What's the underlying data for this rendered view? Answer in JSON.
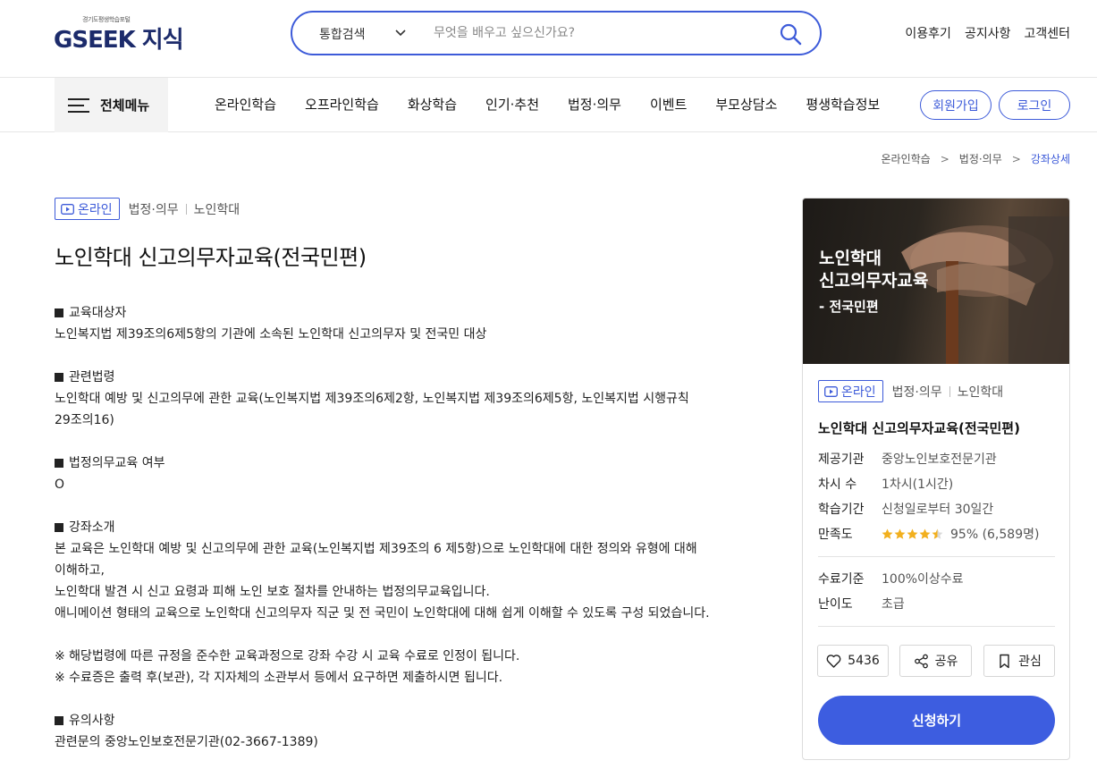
{
  "header": {
    "logo_sub": "경기도평생학습포털",
    "logo_text": "GSEEK 지식",
    "search_category": "통합검색",
    "search_placeholder": "무엇을 배우고 싶으신가요?",
    "links": [
      "이용후기",
      "공지사항",
      "고객센터"
    ]
  },
  "nav": {
    "all_menu": "전체메뉴",
    "items": [
      "온라인학습",
      "오프라인학습",
      "화상학습",
      "인기·추천",
      "법정·의무",
      "이벤트",
      "부모상담소",
      "평생학습정보"
    ],
    "join": "회원가입",
    "login": "로그인"
  },
  "breadcrumb": [
    "온라인학습",
    "법정·의무",
    "강좌상세"
  ],
  "course": {
    "badge": "온라인",
    "category1": "법정·의무",
    "category2": "노인학대",
    "title": "노인학대 신고의무자교육(전국민편)"
  },
  "sections": [
    {
      "heading": "교육대상자",
      "lines": [
        "노인복지법 제39조의6제5항의 기관에 소속된 노인학대 신고의무자 및 전국민 대상"
      ]
    },
    {
      "heading": "관련법령",
      "lines": [
        "노인학대 예방 및 신고의무에 관한 교육(노인복지법 제39조의6제2항, 노인복지법 제39조의6제5항, 노인복지법 시행규칙",
        "29조의16)"
      ]
    },
    {
      "heading": "법정의무교육 여부",
      "lines": [
        "O"
      ]
    },
    {
      "heading": "강좌소개",
      "lines": [
        "본 교육은 노인학대 예방 및 신고의무에 관한 교육(노인복지법 제39조의 6 제5항)으로 노인학대에 대한 정의와 유형에 대해",
        "이해하고,",
        "노인학대 발견 시 신고 요령과 피해 노인 보호 절차를 안내하는 법정의무교육입니다.",
        "애니메이션 형태의 교육으로 노인학대 신고의무자 직군 및 전 국민이 노인학대에 대해 쉽게 이해할 수 있도록 구성 되었습니다."
      ]
    },
    {
      "heading": "",
      "lines": [
        "※ 해당법령에 따른 규정을 준수한 교육과정으로 강좌 수강 시 교육 수료로 인정이 됩니다.",
        "※ 수료증은 출력 후(보관), 각 지자체의 소관부서 등에서 요구하면 제출하시면 됩니다."
      ]
    },
    {
      "heading": "유의사항",
      "lines": [
        "관련문의 중앙노인보호전문기관(02-3667-1389)"
      ]
    }
  ],
  "card": {
    "thumb_line1": "노인학대",
    "thumb_line2": "신고의무자교육",
    "thumb_line3": "- 전국민편",
    "badge": "온라인",
    "category1": "법정·의무",
    "category2": "노인학대",
    "title": "노인학대 신고의무자교육(전국민편)",
    "info": [
      {
        "k": "제공기관",
        "v": "중앙노인보호전문기관"
      },
      {
        "k": "차시 수",
        "v": "1차시(1시간)"
      },
      {
        "k": "학습기간",
        "v": "신청일로부터 30일간"
      }
    ],
    "rating_label": "만족도",
    "rating_stars": 4.5,
    "rating_text": "95% (6,589명)",
    "info2": [
      {
        "k": "수료기준",
        "v": "100%이상수료"
      },
      {
        "k": "난이도",
        "v": "초급"
      }
    ],
    "like_count": "5436",
    "share": "공유",
    "favorite": "관심",
    "apply": "신청하기"
  },
  "colors": {
    "accent": "#3d5bd9",
    "apply_bg": "#3d5de0",
    "star": "#f2b01e"
  }
}
